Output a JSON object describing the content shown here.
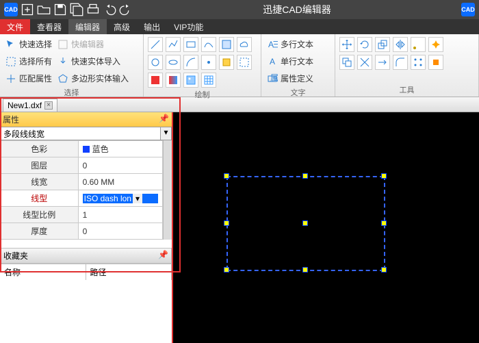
{
  "app": {
    "title": "迅捷CAD编辑器",
    "logo": "CAD"
  },
  "quickaccess": {
    "new": "新建",
    "open": "打开",
    "save": "保存",
    "saveall": "全部保存",
    "print": "打印",
    "undo": "撤销",
    "redo": "重做"
  },
  "menu": {
    "file": "文件",
    "viewer": "查看器",
    "editor": "编辑器",
    "advanced": "高级",
    "output": "输出",
    "vip": "VIP功能"
  },
  "ribbon": {
    "group_select": {
      "label": "选择",
      "quick_select": "快速选择",
      "quick_editor": "快编辑器",
      "select_all": "选择所有",
      "quick_import": "快速实体导入",
      "match_props": "匹配属性",
      "poly_input": "多边形实体输入"
    },
    "group_draw": {
      "label": "绘制"
    },
    "group_text": {
      "label": "文字",
      "mtext": "多行文本",
      "stext": "单行文本",
      "attdef": "属性定义"
    },
    "group_tools": {
      "label": "工具"
    }
  },
  "tabs": {
    "file1": "New1.dxf"
  },
  "properties": {
    "panel_title": "属性",
    "combo_value": "多段线线宽",
    "rows": {
      "color": {
        "k": "色彩",
        "v": "蓝色"
      },
      "layer": {
        "k": "图层",
        "v": "0"
      },
      "lineweight": {
        "k": "线宽",
        "v": "0.60 MM"
      },
      "linetype": {
        "k": "线型",
        "v": "ISO dash lon"
      },
      "ltscale": {
        "k": "线型比例",
        "v": "1"
      },
      "thickness": {
        "k": "厚度",
        "v": "0"
      }
    },
    "favorites": {
      "title": "收藏夹",
      "col_name": "名称",
      "col_path": "路径"
    }
  }
}
